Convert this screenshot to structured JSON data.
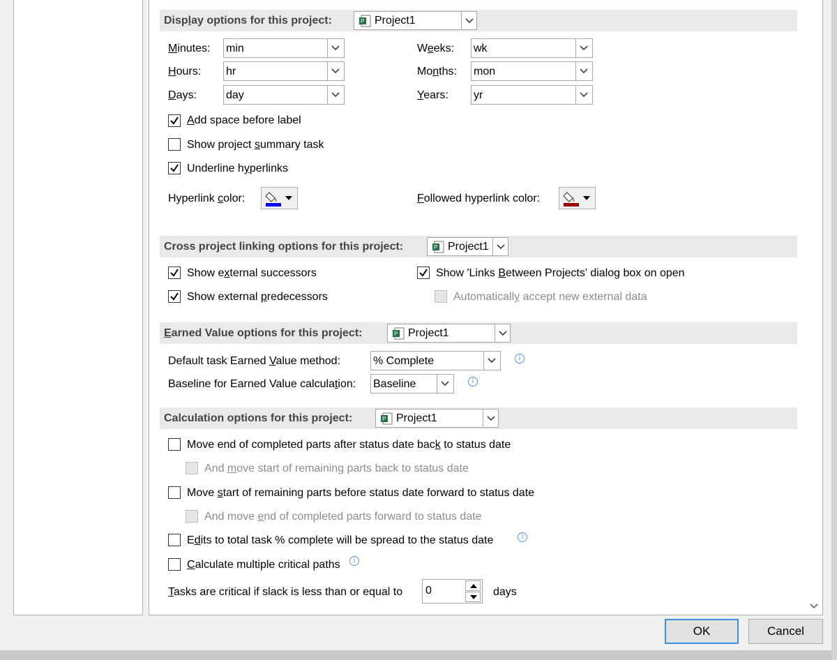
{
  "display": {
    "title": "Display options for this project:",
    "project": "Project1",
    "units": {
      "minutes": {
        "label": "Minutes:",
        "value": "min"
      },
      "hours": {
        "label": "Hours:",
        "value": "hr"
      },
      "days": {
        "label": "Days:",
        "value": "day"
      },
      "weeks": {
        "label": "Weeks:",
        "value": "wk"
      },
      "months": {
        "label": "Months:",
        "value": "mon"
      },
      "years": {
        "label": "Years:",
        "value": "yr"
      }
    },
    "add_space": {
      "label": "Add space before label",
      "checked": true
    },
    "show_summary": {
      "label": "Show project summary task",
      "checked": false
    },
    "underline_links": {
      "label": "Underline hyperlinks",
      "checked": true
    },
    "hyperlink_color_label": "Hyperlink color:",
    "hyperlink_color": "#0000ff",
    "followed_color_label": "Followed hyperlink color:",
    "followed_color": "#990000"
  },
  "cross": {
    "title": "Cross project linking options for this project:",
    "project": "Project1",
    "ext_successors": {
      "label": "Show external successors",
      "checked": true
    },
    "ext_predecessors": {
      "label": "Show external predecessors",
      "checked": true
    },
    "links_dialog": {
      "label": "Show 'Links Between Projects' dialog box on open",
      "checked": true
    },
    "auto_accept": {
      "label": "Automatically accept new external data",
      "checked": false,
      "disabled": true
    }
  },
  "earned": {
    "title": "Earned Value options for this project:",
    "project": "Project1",
    "method_label": "Default task Earned Value method:",
    "method_value": "% Complete",
    "baseline_label": "Baseline for Earned Value calculation:",
    "baseline_value": "Baseline"
  },
  "calc": {
    "title": "Calculation options for this project:",
    "project": "Project1",
    "move_end": {
      "label": "Move end of completed parts after status date back to status date",
      "checked": false
    },
    "move_start_back": {
      "label": "And move start of remaining parts back to status date",
      "checked": false,
      "disabled": true
    },
    "move_start": {
      "label": "Move start of remaining parts before status date forward to status date",
      "checked": false
    },
    "move_end_forward": {
      "label": "And move end of completed parts forward to status date",
      "checked": false,
      "disabled": true
    },
    "edits_spread": {
      "label": "Edits to total task % complete will be spread to the status date",
      "checked": false
    },
    "multi_critical": {
      "label": "Calculate multiple critical paths",
      "checked": false
    },
    "slack_label": "Tasks are critical if slack is less than or equal to",
    "slack_value": "0",
    "slack_unit": "days"
  },
  "buttons": {
    "ok": "OK",
    "cancel": "Cancel"
  }
}
